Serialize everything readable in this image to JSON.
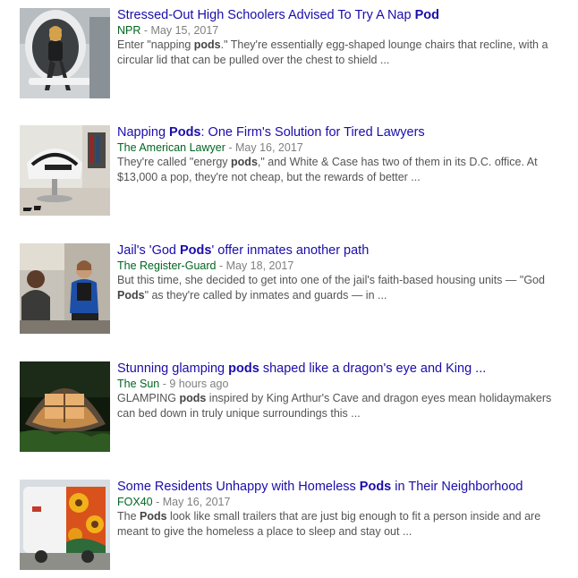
{
  "results": [
    {
      "title": [
        "Stressed-Out High Schoolers Advised To Try A Nap ",
        "Pod",
        ""
      ],
      "source": "NPR",
      "separator": " - ",
      "date": "May 15, 2017",
      "snippet": [
        "Enter \"napping ",
        "pods",
        ".\" They're essentially egg-shaped lounge chairs that recline, with a circular lid that can be pulled over the chest to shield ..."
      ]
    },
    {
      "title": [
        "Napping ",
        "Pods",
        ": One Firm's Solution for Tired Lawyers"
      ],
      "source": "The American Lawyer",
      "separator": " - ",
      "date": "May 16, 2017",
      "snippet": [
        "They're called \"energy ",
        "pods",
        ",\" and White & Case has two of them in its D.C. office. At $13,000 a pop, they're not cheap, but the rewards of better ..."
      ]
    },
    {
      "title": [
        "Jail's 'God ",
        "Pods",
        "' offer inmates another path"
      ],
      "source": "The Register-Guard",
      "separator": " - ",
      "date": "May 18, 2017",
      "snippet": [
        "But this time, she decided to get into one of the jail's faith-based housing units — \"God ",
        "Pods",
        "\" as they're called by inmates and guards — in ..."
      ]
    },
    {
      "title": [
        "Stunning glamping ",
        "pods",
        " shaped like a dragon's eye and King ..."
      ],
      "source": "The Sun",
      "separator": " - ",
      "date": "9 hours ago",
      "snippet": [
        "GLAMPING ",
        "pods",
        " inspired by King Arthur's Cave and dragon eyes mean holidaymakers can bed down in truly unique surroundings this ..."
      ]
    },
    {
      "title": [
        "Some Residents Unhappy with Homeless ",
        "Pods",
        " in Their Neighborhood"
      ],
      "source": "FOX40",
      "separator": " - ",
      "date": "May 16, 2017",
      "snippet": [
        "The ",
        "Pods",
        " look like small trailers that are just big enough to fit a person inside and are meant to give the homeless a place to sleep and stay out ..."
      ]
    }
  ],
  "colors": {
    "title_link": "#1a0dab",
    "source": "#006621",
    "date": "#808080",
    "snippet": "#545454"
  }
}
